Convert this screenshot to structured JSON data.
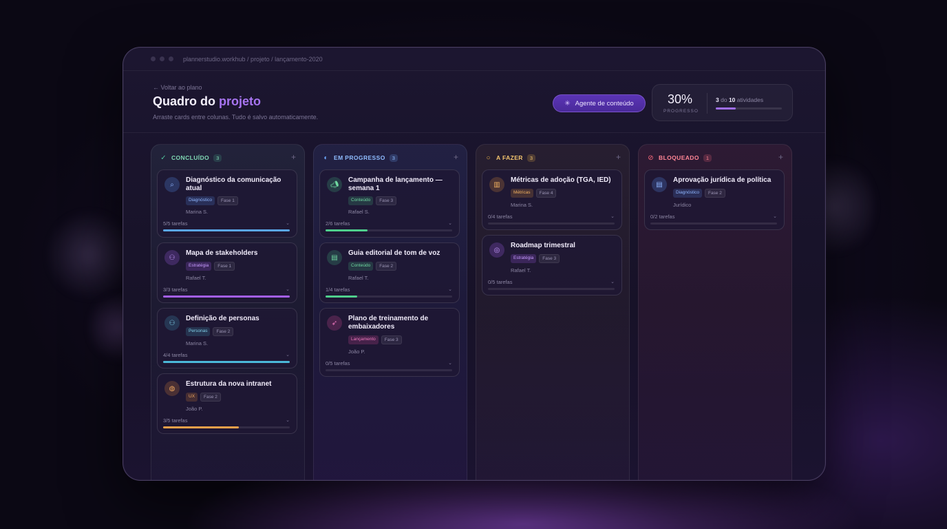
{
  "window": {
    "path": "plannerstudio.workhub / projeto / lançamento-2020"
  },
  "header": {
    "back": "← Voltar ao plano",
    "title_main": "Quadro do",
    "title_accent": "projeto",
    "subtitle": "Arraste cards entre colunas. Tudo é salvo automaticamente.",
    "agent_button": "Agente de conteúdo",
    "progress": {
      "percent": "30%",
      "label": "PROGRESSO",
      "done": "3",
      "of_text": "do",
      "total": "10",
      "unit": "atividades",
      "fraction": 0.3
    }
  },
  "columns": {
    "done": {
      "title": "CONCLUÍDO",
      "count": "3",
      "icon": "check-icon",
      "color": "#4fc39a"
    },
    "progress": {
      "title": "EM PROGRESSO",
      "count": "3",
      "icon": "half-circle-icon",
      "color": "#6fa8ff"
    },
    "todo": {
      "title": "A FAZER",
      "count": "3",
      "icon": "circle-icon",
      "color": "#f0b64a"
    },
    "blocked": {
      "title": "BLOQUEADO",
      "count": "1",
      "icon": "blocked-icon",
      "color": "#ff6b7d"
    }
  },
  "cards": {
    "d1": {
      "title": "Diagnóstico da comunicação atual",
      "tag": "Diagnóstico",
      "phase": "Fase 1",
      "owner": "Marina S.",
      "tasks": "5/5 tarefas",
      "progress": 1.0,
      "icon": "search-icon"
    },
    "d2": {
      "title": "Mapa de stakeholders",
      "tag": "Estratégia",
      "phase": "Fase 1",
      "owner": "Rafael T.",
      "tasks": "3/3 tarefas",
      "progress": 1.0,
      "icon": "people-icon"
    },
    "d3": {
      "title": "Definição de personas",
      "tag": "Personas",
      "phase": "Fase 2",
      "owner": "Marina S.",
      "tasks": "4/4 tarefas",
      "progress": 1.0,
      "icon": "people-icon"
    },
    "d4": {
      "title": "Estrutura da nova intranet",
      "tag": "UX",
      "phase": "Fase 2",
      "owner": "João P.",
      "tasks": "3/5 tarefas",
      "progress": 0.6,
      "icon": "globe-icon"
    },
    "p1": {
      "title": "Campanha de lançamento — semana 1",
      "tag": "Conteúdo",
      "phase": "Fase 3",
      "owner": "Rafael S.",
      "tasks": "2/6 tarefas",
      "progress": 0.33,
      "icon": "megaphone-icon"
    },
    "p2": {
      "title": "Guia editorial de tom de voz",
      "tag": "Conteúdo",
      "phase": "Fase 2",
      "owner": "Rafael T.",
      "tasks": "1/4 tarefas",
      "progress": 0.25,
      "icon": "document-icon"
    },
    "p3": {
      "title": "Plano de treinamento de embaixadores",
      "tag": "Lançamento",
      "phase": "Fase 3",
      "owner": "João P.",
      "tasks": "0/5 tarefas",
      "progress": 0,
      "icon": "rocket-icon"
    },
    "t1": {
      "title": "Métricas de adoção (TGA, IED)",
      "tag": "Métricas",
      "phase": "Fase 4",
      "owner": "Marina S.",
      "tasks": "0/4 tarefas",
      "progress": 0,
      "icon": "chart-icon"
    },
    "t2": {
      "title": "Roadmap trimestral",
      "tag": "Estratégia",
      "phase": "Fase 3",
      "owner": "Rafael T.",
      "tasks": "0/5 tarefas",
      "progress": 0,
      "icon": "target-icon"
    },
    "b1": {
      "title": "Aprovação jurídica de política",
      "tag": "Diagnóstico",
      "phase": "Fase 2",
      "owner": "Jurídico",
      "tasks": "0/2 tarefas",
      "progress": 0,
      "icon": "document-icon"
    }
  }
}
